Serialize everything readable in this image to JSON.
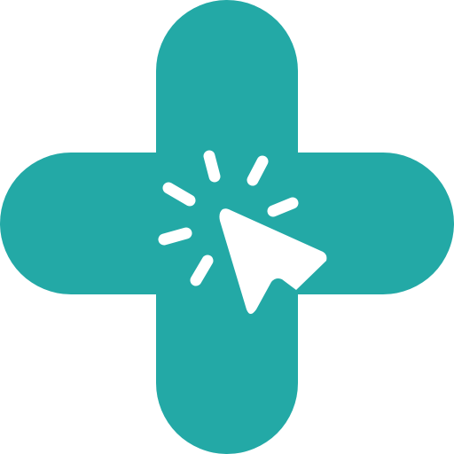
{
  "logo": {
    "shape": "rounded-plus-cross",
    "icon": "cursor-click-icon",
    "colors": {
      "cross": "#23a9a6",
      "icon": "#ffffff",
      "background": "#ffffff"
    }
  }
}
